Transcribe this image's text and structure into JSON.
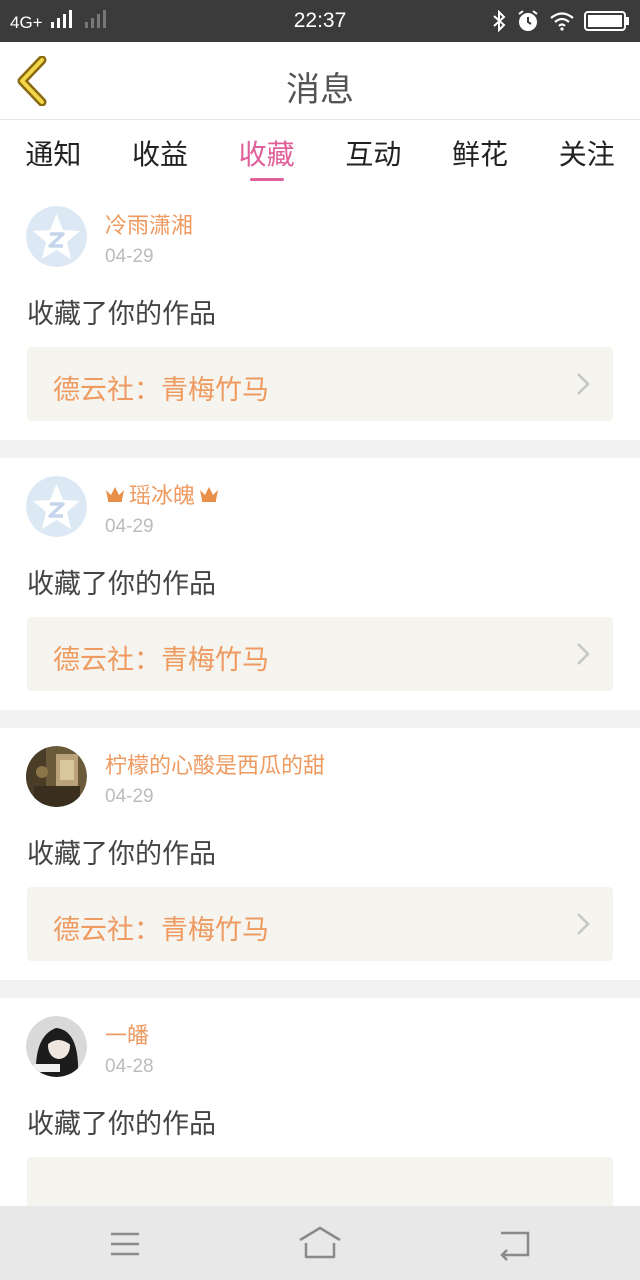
{
  "status_bar": {
    "network": "4G+",
    "time": "22:37",
    "icons": [
      "signal-icon",
      "bluetooth-icon",
      "alarm-icon",
      "wifi-icon",
      "battery-icon"
    ]
  },
  "header": {
    "title": "消息",
    "back_icon": "chevron-left-icon"
  },
  "tabs": [
    {
      "label": "通知",
      "active": false
    },
    {
      "label": "收益",
      "active": false
    },
    {
      "label": "收藏",
      "active": true
    },
    {
      "label": "互动",
      "active": false
    },
    {
      "label": "鲜花",
      "active": false
    },
    {
      "label": "关注",
      "active": false
    }
  ],
  "messages": [
    {
      "user": "冷雨潇湘",
      "date": "04-29",
      "action": "收藏了你的作品",
      "work": "德云社：青梅竹马",
      "avatar": "default-avatar-icon",
      "crowned": false
    },
    {
      "user": "瑶冰魄",
      "date": "04-29",
      "action": "收藏了你的作品",
      "work": "德云社：青梅竹马",
      "avatar": "default-avatar-icon",
      "crowned": true
    },
    {
      "user": "柠檬的心酸是西瓜的甜",
      "date": "04-29",
      "action": "收藏了你的作品",
      "work": "德云社：青梅竹马",
      "avatar": "user-photo-avatar",
      "crowned": false
    },
    {
      "user": "一皤",
      "date": "04-28",
      "action": "收藏了你的作品",
      "work": "",
      "avatar": "user-photo-avatar",
      "crowned": false
    }
  ],
  "nav_bar": {
    "icons": [
      "menu-icon",
      "home-icon",
      "back-icon"
    ]
  },
  "colors": {
    "accent": "#e0609a",
    "username": "#ee9a60",
    "status_bar": "#3b3b3b",
    "link_bg": "#f6f4ee"
  }
}
